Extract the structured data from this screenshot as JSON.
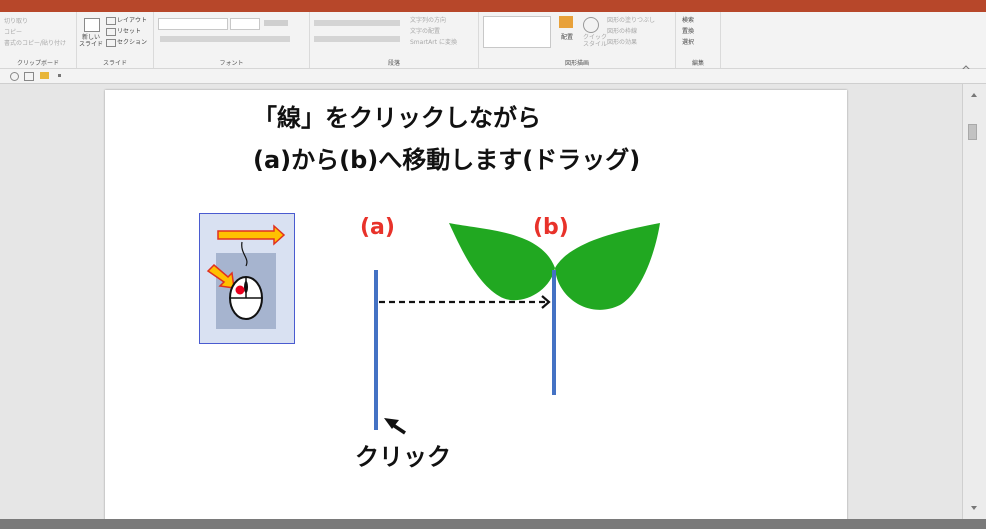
{
  "ribbon": {
    "clipboard": {
      "cut": "切り取り",
      "copy": "コピー",
      "format_painter": "書式のコピー/貼り付け",
      "group": "クリップボード"
    },
    "slides": {
      "new_slide": "新しい",
      "new_slide2": "スライド",
      "layout": "レイアウト",
      "reset": "リセット",
      "section": "セクション",
      "group": "スライド"
    },
    "font": {
      "group": "フォント"
    },
    "paragraph": {
      "text_direction": "文字列の方向",
      "align_text": "文字の配置",
      "smartart": "SmartArt に変換",
      "group": "段落"
    },
    "drawing": {
      "arrange": "配置",
      "quick_styles": "クイック",
      "quick_styles2": "スタイル",
      "fill": "図形の塗りつぶし",
      "outline": "図形の枠線",
      "effects": "図形の効果",
      "group": "図形描画"
    },
    "editing": {
      "find": "検索",
      "replace": "置換",
      "select": "選択",
      "group": "編集"
    }
  },
  "slide": {
    "title_line1": "「線」をクリックしながら",
    "title_line2": "(a)から(b)へ移動します(ドラッグ)",
    "label_a": "(a)",
    "label_b": "(b)",
    "click_label": "クリック"
  },
  "colors": {
    "accent": "#b7472a",
    "line": "#4472c4",
    "label_red": "#e8322a",
    "leaf": "#21a821",
    "icon_box": "#d9e1f2"
  }
}
